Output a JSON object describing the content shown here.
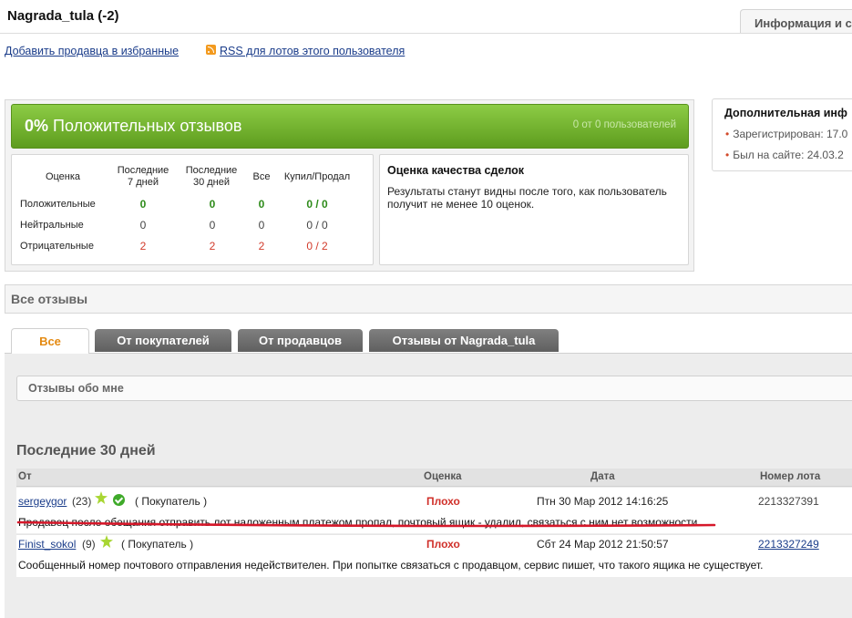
{
  "header": {
    "title": "Nagrada_tula (-2)",
    "info_tab": "Информация и с",
    "favorite_link": "Добавить продавца в избранные",
    "rss_link": "RSS для лотов этого пользователя"
  },
  "rating": {
    "percent": "0%",
    "percent_label": "Положительных отзывов",
    "users_text": "0 от 0 пользователей"
  },
  "stats": {
    "headers": [
      "Оценка",
      "Последние\n7 дней",
      "Последние\n30 дней",
      "Все",
      "Купил/Продал"
    ],
    "rows": [
      {
        "label": "Положительные",
        "d7": "0",
        "d30": "0",
        "all": "0",
        "buy_sell": "0 / 0"
      },
      {
        "label": "Нейтральные",
        "d7": "0",
        "d30": "0",
        "all": "0",
        "buy_sell": "0 / 0"
      },
      {
        "label": "Отрицательные",
        "d7": "2",
        "d30": "2",
        "all": "2",
        "buy_sell": "0 / 2"
      }
    ]
  },
  "quality": {
    "title": "Оценка качества сделок",
    "text": "Результаты станут видны после того, как пользователь получит не менее 10 оценок."
  },
  "additional": {
    "title": "Дополнительная инф",
    "registered": "Зарегистрирован: 17.0",
    "last_seen": "Был на сайте: 24.03.2"
  },
  "reviews": {
    "section_title": "Все отзывы",
    "tabs": [
      "Все",
      "От покупателей",
      "От продавцов",
      "Отзывы от Nagrada_tula"
    ],
    "about_me": "Отзывы обо мне",
    "period_title": "Последние 30 дней",
    "columns": [
      "От",
      "Оценка",
      "Дата",
      "Номер лота"
    ],
    "items": [
      {
        "user": "sergeygor",
        "count": "(23)",
        "role": "( Покупатель )",
        "rating": "Плохо",
        "date": "Птн 30 Мар 2012 14:16:25",
        "lot": "2213327391",
        "comment": "Продавец после обещания отправить лот наложенным платежом пропал, почтовый ящик - удалил, связаться с ним нет возможности."
      },
      {
        "user": "Finist_sokol",
        "count": "(9)",
        "role": "( Покупатель )",
        "rating": "Плохо",
        "date": "Сбт 24 Мар 2012 21:50:57",
        "lot": "2213327249",
        "comment": "Сообщенный номер почтового отправления недействителен. При попытке связаться с продавцом, сервис пишет, что такого ящика не существует."
      }
    ]
  },
  "colors": {
    "positive": "#2e8b1a",
    "negative": "#d23a2a",
    "accent_tab": "#e48a12",
    "annotation": "#d6182a"
  }
}
